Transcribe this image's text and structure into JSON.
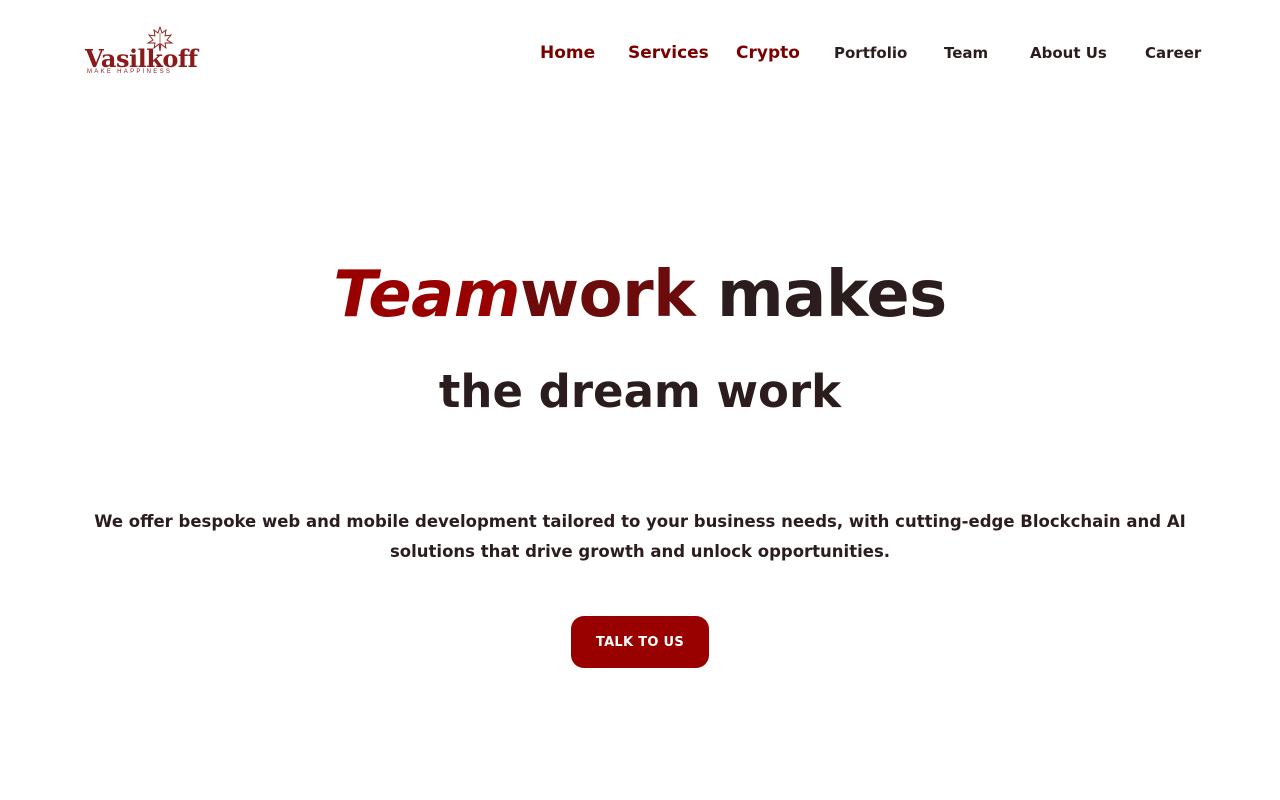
{
  "header": {
    "logo": {
      "name": "Vasilkoff",
      "tagline": "MAKE HAPPINESS"
    },
    "nav": [
      {
        "label": "Home"
      },
      {
        "label": "Services"
      },
      {
        "label": "Crypto"
      },
      {
        "label": "Portfolio"
      },
      {
        "label": "Team"
      },
      {
        "label": "About Us"
      },
      {
        "label": "Career"
      }
    ]
  },
  "hero": {
    "headline_team": "Team",
    "headline_work": "work",
    "headline_makes": " makes",
    "subheadline": "the dream work",
    "description": "We offer bespoke web and mobile development tailored to your business needs, with cutting-edge Blockchain and AI solutions that drive growth and unlock opportunities.",
    "cta_label": "TALK TO US"
  },
  "colors": {
    "accent": "#990000",
    "accent_dark": "#7a0000",
    "text": "#2b1d1d",
    "background": "#ffffff"
  }
}
